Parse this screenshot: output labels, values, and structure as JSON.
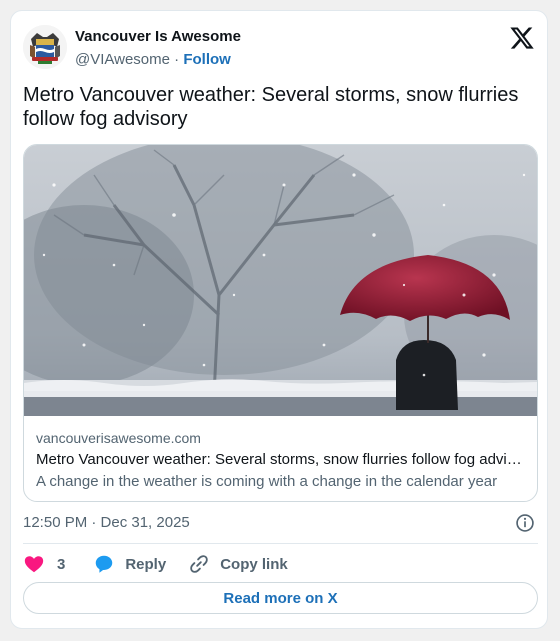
{
  "author": {
    "name": "Vancouver Is Awesome",
    "handle": "@VIAwesome",
    "separator": "·",
    "follow_label": "Follow"
  },
  "tweet": {
    "text": "Metro Vancouver weather: Several storms, snow flurries follow fog advisory",
    "timestamp": "12:50 PM · Dec 31, 2025"
  },
  "link_card": {
    "domain": "vancouverisawesome.com",
    "title": "Metro Vancouver weather: Several storms, snow flurries follow fog advisory",
    "description": "A change in the weather is coming with a change in the calendar year"
  },
  "actions": {
    "like_count": "3",
    "reply_label": "Reply",
    "copy_link_label": "Copy link"
  },
  "read_more_label": "Read more on X",
  "colors": {
    "accent": "#1d70b8",
    "like": "#f91880",
    "reply": "#1d9bf0",
    "umbrella": "#9b1c35"
  }
}
